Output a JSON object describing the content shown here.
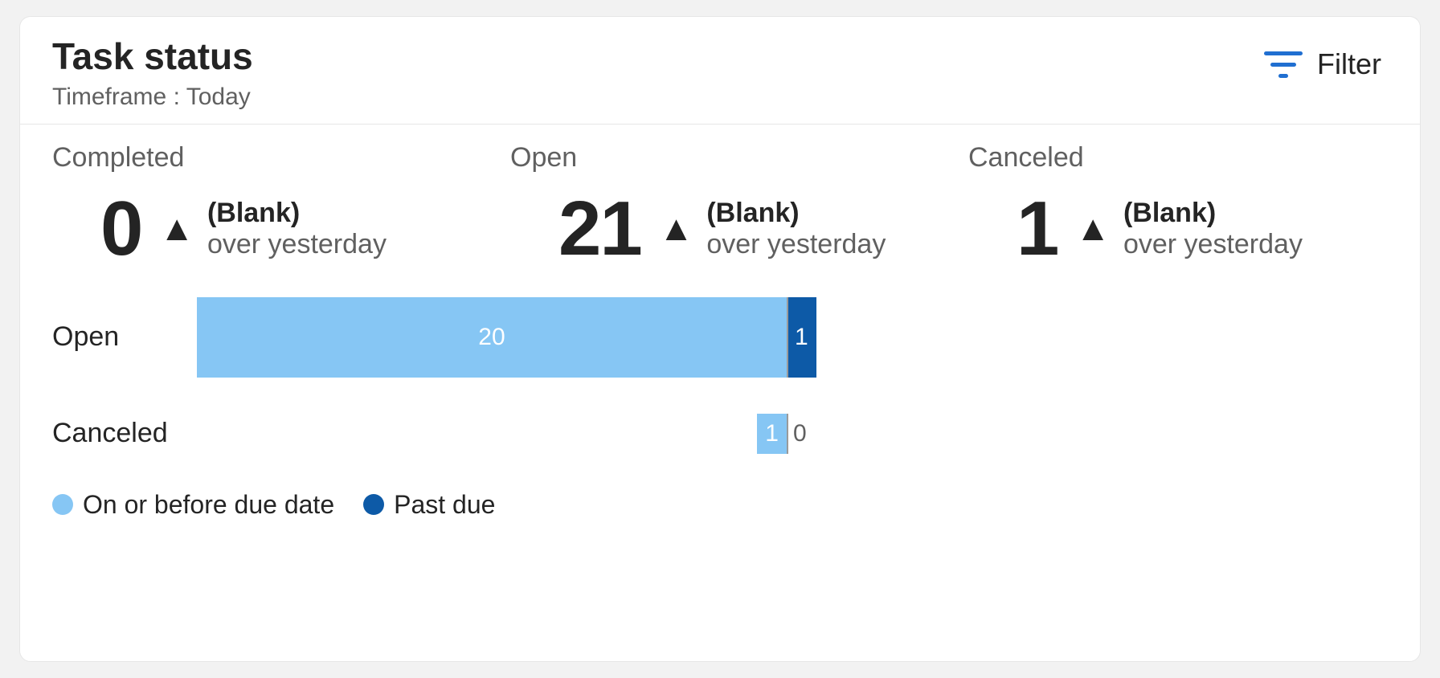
{
  "header": {
    "title": "Task status",
    "subtitle": "Timeframe : Today",
    "filter_label": "Filter"
  },
  "colors": {
    "series_on_or_before": "#86c6f4",
    "series_past_due": "#0d5aa7",
    "filter_icon": "#206fd1"
  },
  "metrics": [
    {
      "label": "Completed",
      "value": "0",
      "delta": "(Blank)",
      "caption": "over yesterday"
    },
    {
      "label": "Open",
      "value": "21",
      "delta": "(Blank)",
      "caption": "over yesterday"
    },
    {
      "label": "Canceled",
      "value": "1",
      "delta": "(Blank)",
      "caption": "over yesterday"
    }
  ],
  "legend": {
    "on_or_before": "On or before due date",
    "past_due": "Past due"
  },
  "chart_data": {
    "type": "bar",
    "orientation": "horizontal",
    "stacked": true,
    "categories": [
      "Open",
      "Canceled"
    ],
    "series": [
      {
        "name": "On or before due date",
        "values": [
          20,
          1
        ],
        "color": "#86c6f4"
      },
      {
        "name": "Past due",
        "values": [
          1,
          0
        ],
        "color": "#0d5aa7"
      }
    ],
    "title": "",
    "xlabel": "",
    "ylabel": "",
    "xlim": [
      0,
      21
    ]
  }
}
